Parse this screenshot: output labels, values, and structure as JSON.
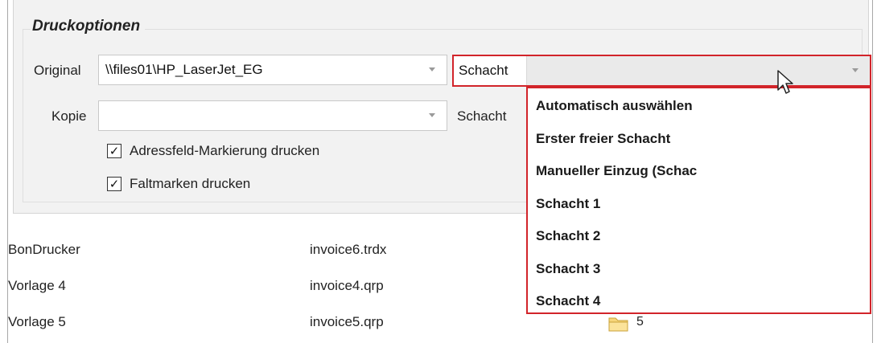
{
  "print_options": {
    "title": "Druckoptionen",
    "original": {
      "label": "Original",
      "printer_value": "\\\\files01\\HP_LaserJet_EG",
      "tray_label": "Schacht",
      "tray_value": ""
    },
    "copy": {
      "label": "Kopie",
      "printer_value": "",
      "tray_label": "Schacht"
    },
    "checkboxes": [
      {
        "label": "Adressfeld-Markierung drucken",
        "checked": true
      },
      {
        "label": "Faltmarken drucken",
        "checked": true
      }
    ],
    "check_glyph": "✓",
    "tray_dropdown": {
      "options": [
        "Automatisch auswählen",
        "Erster freier Schacht",
        "Manueller Einzug (Schac",
        "Schacht 1",
        "Schacht 2",
        "Schacht 3",
        "Schacht 4"
      ]
    }
  },
  "template_list": {
    "rows": [
      {
        "name": "BonDrucker",
        "file": "invoice6.trdx"
      },
      {
        "name": "Vorlage 4",
        "file": "invoice4.qrp"
      },
      {
        "name": "Vorlage 5",
        "file": "invoice5.qrp",
        "number": "5"
      }
    ]
  },
  "colors": {
    "highlight_border": "#d2242a",
    "panel_background": "#f2f2f2"
  }
}
